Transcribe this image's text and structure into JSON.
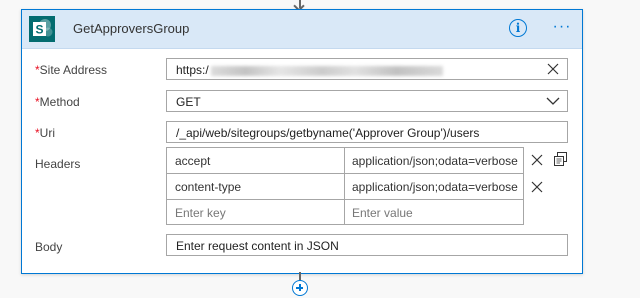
{
  "action": {
    "title": "GetApproversGroup",
    "info_icon": "info-icon",
    "more_icon": "ellipsis-icon",
    "info_glyph": "i",
    "more_glyph": "···"
  },
  "fields": {
    "site_address": {
      "label": "Site Address",
      "required_mark": "*",
      "value_prefix": "https:/"
    },
    "method": {
      "label": "Method",
      "required_mark": "*",
      "value": "GET"
    },
    "uri": {
      "label": "Uri",
      "required_mark": "*",
      "value": "/_api/web/sitegroups/getbyname('Approver Group')/users"
    },
    "headers": {
      "label": "Headers",
      "rows": [
        {
          "key": "accept",
          "value": "application/json;odata=verbose"
        },
        {
          "key": "content-type",
          "value": "application/json;odata=verbose"
        }
      ],
      "key_placeholder": "Enter key",
      "value_placeholder": "Enter value"
    },
    "body": {
      "label": "Body",
      "placeholder": "Enter request content in JSON"
    }
  },
  "colors": {
    "accent": "#0078d4",
    "header_bg": "#d9e8f7",
    "required": "#e81123",
    "sharepoint": "#036c70"
  }
}
